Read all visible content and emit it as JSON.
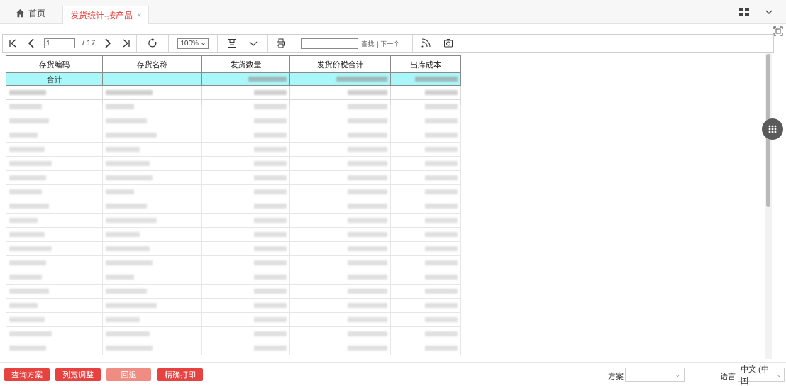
{
  "tabs": {
    "home_label": "首页",
    "active_label": "发货统计-按产品",
    "close_glyph": "×"
  },
  "toolbar": {
    "page_current": "1",
    "page_total": "/ 17",
    "zoom": "100%",
    "find_label": "查找",
    "next_label": "| 下一个"
  },
  "table": {
    "headers": [
      "存货编码",
      "存货名称",
      "发货数量",
      "发货价税合计",
      "出库成本"
    ],
    "total_label": "合计"
  },
  "bottom": {
    "buttons": [
      "查询方案",
      "列宽调整",
      "回退",
      "精确打印"
    ],
    "scheme_label": "方案",
    "scheme_value": "",
    "language_label": "语言",
    "language_value": "中文 (中国"
  },
  "colors": {
    "accent": "#e64340",
    "accent_pale": "#ef8d84",
    "total_row": "#a9f7f9"
  }
}
